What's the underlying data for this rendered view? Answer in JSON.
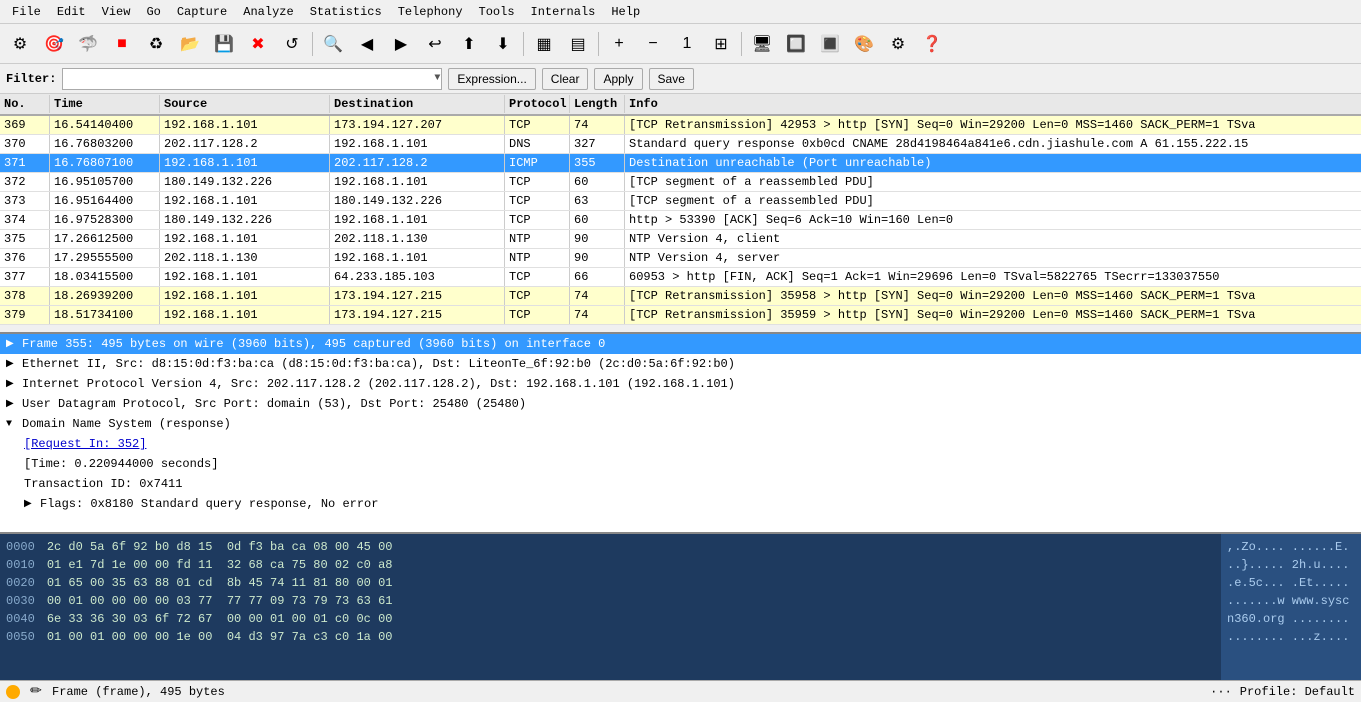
{
  "menu": {
    "items": [
      "File",
      "Edit",
      "View",
      "Go",
      "Capture",
      "Analyze",
      "Statistics",
      "Telephony",
      "Tools",
      "Internals",
      "Help"
    ]
  },
  "filter": {
    "label": "Filter:",
    "placeholder": "",
    "buttons": [
      "Expression...",
      "Clear",
      "Apply",
      "Save"
    ]
  },
  "columns": {
    "no": "No.",
    "time": "Time",
    "source": "Source",
    "destination": "Destination",
    "protocol": "Protocol",
    "length": "Length",
    "info": "Info"
  },
  "packets": [
    {
      "no": "369",
      "time": "16.54140400",
      "src": "192.168.1.101",
      "dst": "173.194.127.207",
      "proto": "TCP",
      "len": "74",
      "info": "[TCP Retransmission] 42953 > http [SYN] Seq=0 Win=29200 Len=0 MSS=1460 SACK_PERM=1 TSva",
      "bg": "bg-yellow",
      "selected": false
    },
    {
      "no": "370",
      "time": "16.76803200",
      "src": "202.117.128.2",
      "dst": "192.168.1.101",
      "proto": "DNS",
      "len": "327",
      "info": "Standard query response 0xb0cd  CNAME 28d4198464a841e6.cdn.jiashule.com A 61.155.222.15",
      "bg": "bg-white",
      "selected": false
    },
    {
      "no": "371",
      "time": "16.76807100",
      "src": "192.168.1.101",
      "dst": "202.117.128.2",
      "proto": "ICMP",
      "len": "355",
      "info": "Destination unreachable (Port unreachable)",
      "bg": "bg-green",
      "selected": true
    },
    {
      "no": "372",
      "time": "16.95105700",
      "src": "180.149.132.226",
      "dst": "192.168.1.101",
      "proto": "TCP",
      "len": "60",
      "info": "[TCP segment of a reassembled PDU]",
      "bg": "bg-white",
      "selected": false
    },
    {
      "no": "373",
      "time": "16.95164400",
      "src": "192.168.1.101",
      "dst": "180.149.132.226",
      "proto": "TCP",
      "len": "63",
      "info": "[TCP segment of a reassembled PDU]",
      "bg": "bg-white",
      "selected": false
    },
    {
      "no": "374",
      "time": "16.97528300",
      "src": "180.149.132.226",
      "dst": "192.168.1.101",
      "proto": "TCP",
      "len": "60",
      "info": "http > 53390 [ACK] Seq=6 Ack=10 Win=160 Len=0",
      "bg": "bg-white",
      "selected": false
    },
    {
      "no": "375",
      "time": "17.26612500",
      "src": "192.168.1.101",
      "dst": "202.118.1.130",
      "proto": "NTP",
      "len": "90",
      "info": "NTP Version 4, client",
      "bg": "bg-white",
      "selected": false
    },
    {
      "no": "376",
      "time": "17.29555500",
      "src": "202.118.1.130",
      "dst": "192.168.1.101",
      "proto": "NTP",
      "len": "90",
      "info": "NTP Version 4, server",
      "bg": "bg-white",
      "selected": false
    },
    {
      "no": "377",
      "time": "18.03415500",
      "src": "192.168.1.101",
      "dst": "64.233.185.103",
      "proto": "TCP",
      "len": "66",
      "info": "60953 > http [FIN, ACK] Seq=1 Ack=1 Win=29696 Len=0 TSval=5822765 TSecrr=133037550",
      "bg": "bg-white",
      "selected": false
    },
    {
      "no": "378",
      "time": "18.26939200",
      "src": "192.168.1.101",
      "dst": "173.194.127.215",
      "proto": "TCP",
      "len": "74",
      "info": "[TCP Retransmission] 35958 > http [SYN] Seq=0 Win=29200 Len=0 MSS=1460 SACK_PERM=1 TSva",
      "bg": "bg-yellow",
      "selected": false
    },
    {
      "no": "379",
      "time": "18.51734100",
      "src": "192.168.1.101",
      "dst": "173.194.127.215",
      "proto": "TCP",
      "len": "74",
      "info": "[TCP Retransmission] 35959 > http [SYN] Seq=0 Win=29200 Len=0 MSS=1460 SACK_PERM=1 TSva",
      "bg": "bg-yellow",
      "selected": false
    }
  ],
  "detail": {
    "frame_line": "Frame 355: 495 bytes on wire (3960 bits), 495 captured (3960 bits) on interface 0",
    "ethernet_line": "Ethernet II, Src: d8:15:0d:f3:ba:ca (d8:15:0d:f3:ba:ca), Dst: LiteonTe_6f:92:b0 (2c:d0:5a:6f:92:b0)",
    "ip_line": "Internet Protocol Version 4, Src: 202.117.128.2 (202.117.128.2), Dst: 192.168.1.101 (192.168.1.101)",
    "udp_line": "User Datagram Protocol, Src Port: domain (53), Dst Port: 25480 (25480)",
    "dns_line": "Domain Name System (response)",
    "request_line": "[Request In: 352]",
    "time_line": "[Time: 0.220944000 seconds]",
    "transaction_line": "Transaction ID: 0x7411",
    "flags_line": "Flags: 0x8180 Standard query response, No error"
  },
  "hex": {
    "offsets": [
      "0000",
      "0010",
      "0020",
      "0030",
      "0040",
      "0050"
    ],
    "bytes": [
      "2c d0 5a 6f 92 b0 d8 15  0d f3 ba ca 08 00 45 00",
      "01 e1 7d 1e 00 00 fd 11  32 68 ca 75 80 02 c0 a8",
      "01 65 00 35 63 88 01 cd  8b 45 74 11 81 80 00 01",
      "00 01 00 00 00 00 03 77  77 77 09 73 79 73 63 61",
      "6e 33 36 30 03 6f 72 67  00 00 01 00 01 c0 0c 00",
      "01 00 01 00 00 00 1e 00  04 d3 97 7a c3 c0 1a 00"
    ],
    "ascii": [
      ",.Zo.... ......E.",
      "..}..... 2h.u....",
      ".e.5c... .Et.....",
      ".......w www.sysc",
      "n360.org ........",
      "........ ...z...."
    ]
  },
  "statusbar": {
    "left": "Frame (frame), 495 bytes",
    "right": "Profile: Default"
  }
}
